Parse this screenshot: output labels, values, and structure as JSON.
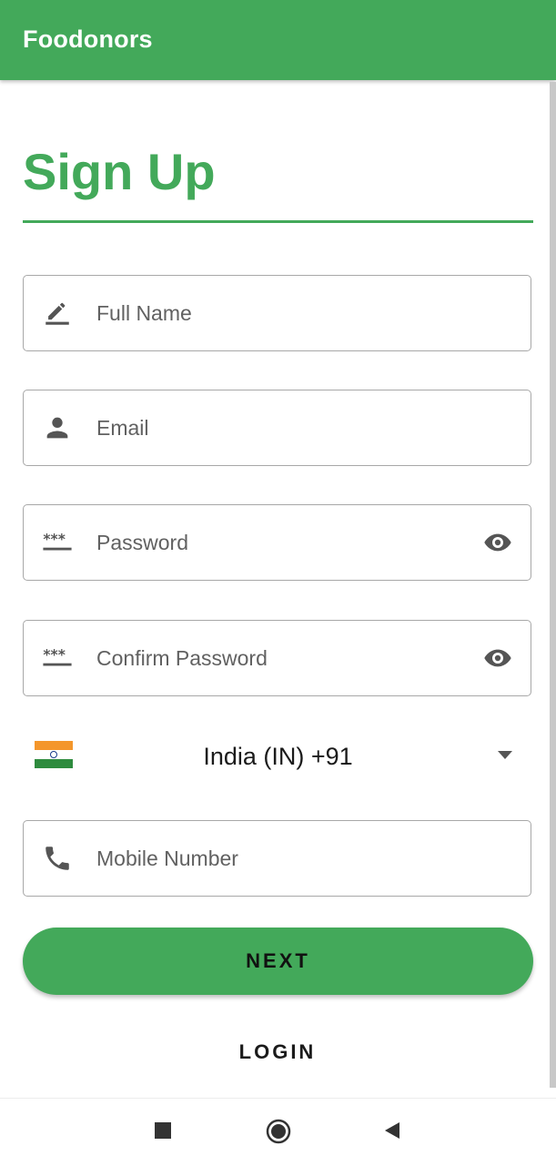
{
  "app_bar": {
    "title": "Foodonors"
  },
  "page": {
    "heading": "Sign Up"
  },
  "form": {
    "full_name": {
      "label": "Full Name",
      "icon": "edit-icon"
    },
    "email": {
      "label": "Email",
      "icon": "person-icon"
    },
    "password": {
      "label": "Password",
      "icon": "password-icon",
      "toggle_icon": "eye-icon"
    },
    "confirm_password": {
      "label": "Confirm Password",
      "icon": "password-icon",
      "toggle_icon": "eye-icon"
    },
    "country": {
      "selected": "India (IN)  +91",
      "flag": "india-flag-icon"
    },
    "mobile": {
      "label": "Mobile Number",
      "icon": "phone-icon"
    }
  },
  "actions": {
    "next_label": "NEXT",
    "login_label": "LOGIN"
  },
  "colors": {
    "primary": "#43a95a",
    "field_border": "#a8a8a8",
    "label": "#616161"
  }
}
